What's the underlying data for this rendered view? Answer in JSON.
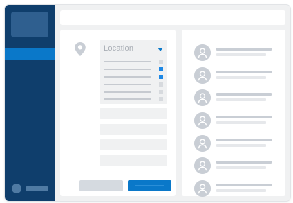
{
  "theme": {
    "sidebar_bg": "#0f3e6c",
    "accent": "#0a78c9",
    "panel_bg": "#ffffff",
    "canvas_bg": "#f0f1f2",
    "placeholder": "#c9ced5"
  },
  "sidebar": {
    "logo": "logo-placeholder",
    "active_item": "nav-item-selected",
    "user_avatar": "avatar-placeholder"
  },
  "location_form": {
    "location_icon": "map-pin-icon",
    "dropdown": {
      "label": "Location",
      "arrow_icon": "caret-down-icon",
      "options": [
        {
          "checked": false
        },
        {
          "checked": true
        },
        {
          "checked": true
        },
        {
          "checked": false
        },
        {
          "checked": false
        },
        {
          "checked": false
        }
      ]
    },
    "fields": [
      "field-1",
      "field-2",
      "field-3",
      "field-4"
    ],
    "buttons": [
      "cancel",
      "submit"
    ]
  },
  "people_list": {
    "avatar_icon": "person-icon",
    "rows": 7
  }
}
